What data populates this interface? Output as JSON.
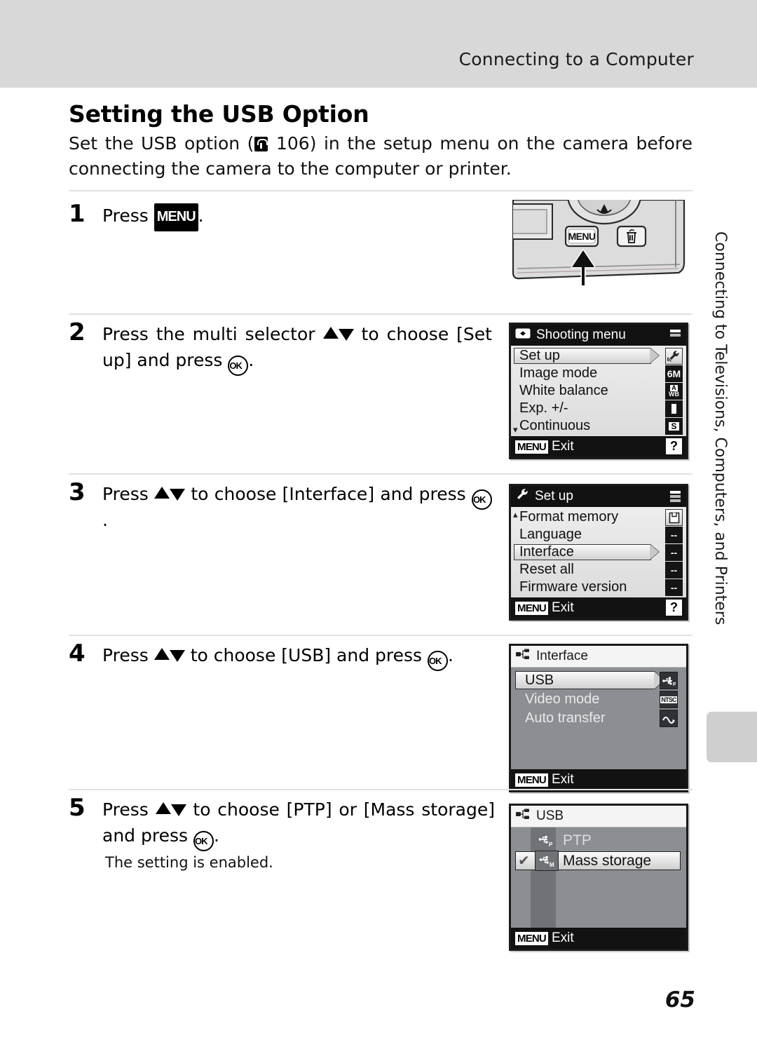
{
  "header": {
    "title": "Connecting to a Computer"
  },
  "heading": "Setting the USB Option",
  "intro": {
    "before": "Set the USB option (",
    "page_ref": "106",
    "after": ") in the setup menu on the camera before connecting the camera to the computer or printer."
  },
  "steps": [
    {
      "num": "1",
      "text_before": "Press ",
      "menu_label": "MENU",
      "text_after": "."
    },
    {
      "num": "2",
      "line1_a": "Press the multi selector ",
      "line1_b": " to choose [Set up] and press ",
      "ok_label": "OK",
      "line1_c": "."
    },
    {
      "num": "3",
      "line_a": "Press ",
      "line_b": " to choose [Interface] and press ",
      "ok_label": "OK",
      "line_c": "."
    },
    {
      "num": "4",
      "line_a": "Press ",
      "line_b": " to choose [USB] and press ",
      "ok_label": "OK",
      "line_c": "."
    },
    {
      "num": "5",
      "line_a": "Press ",
      "line_b": " to choose [PTP] or [Mass storage] and press ",
      "ok_label": "OK",
      "line_c": ".",
      "note": "The setting is enabled."
    }
  ],
  "camera": {
    "menu_button_label": "MENU",
    "delete_button_label": "trash-can"
  },
  "screens": {
    "shooting_menu": {
      "title": "Shooting menu",
      "title_icon": "camera-icon",
      "rows": [
        {
          "label": "Set up",
          "icon": "wrench-icon",
          "icon_text": "",
          "selected": true,
          "light_icon": true
        },
        {
          "label": "Image mode",
          "icon": "image-size-icon",
          "icon_text": "6M",
          "selected": false,
          "light_icon": false
        },
        {
          "label": "White balance",
          "icon": "white-balance-icon",
          "icon_text": "AWB",
          "selected": false,
          "light_icon": false
        },
        {
          "label": "Exp. +/-",
          "icon": "exposure-icon",
          "icon_text": "0",
          "selected": false,
          "light_icon": false
        },
        {
          "label": "Continuous",
          "icon": "continuous-icon",
          "icon_text": "S",
          "selected": false,
          "light_icon": false
        }
      ],
      "footer": {
        "menu": "MENU",
        "exit": "Exit",
        "help": "?"
      }
    },
    "setup_menu": {
      "title": "Set up",
      "title_icon": "wrench-icon",
      "rows": [
        {
          "label": "Format memory",
          "icon": "format-memory-icon",
          "icon_text": "",
          "selected": false,
          "light_icon": true
        },
        {
          "label": "Language",
          "icon": "dashes-icon",
          "icon_text": "--",
          "selected": false,
          "light_icon": false
        },
        {
          "label": "Interface",
          "icon": "dashes-icon",
          "icon_text": "--",
          "selected": true,
          "light_icon": false
        },
        {
          "label": "Reset all",
          "icon": "dashes-icon",
          "icon_text": "--",
          "selected": false,
          "light_icon": false
        },
        {
          "label": "Firmware version",
          "icon": "dashes-icon",
          "icon_text": "--",
          "selected": false,
          "light_icon": false
        }
      ],
      "footer": {
        "menu": "MENU",
        "exit": "Exit",
        "help": "?"
      }
    },
    "interface_menu": {
      "title": "Interface",
      "title_icon": "interface-icon",
      "rows": [
        {
          "label": "USB",
          "icon": "usb-ptp-icon",
          "icon_text": "",
          "selected": true
        },
        {
          "label": "Video mode",
          "icon": "video-ntsc-icon",
          "icon_text": "NTSC",
          "selected": false
        },
        {
          "label": "Auto transfer",
          "icon": "auto-transfer-icon",
          "icon_text": "",
          "selected": false
        }
      ],
      "footer": {
        "menu": "MENU",
        "exit": "Exit"
      }
    },
    "usb_menu": {
      "title": "USB",
      "title_icon": "interface-icon",
      "rows": [
        {
          "label": "PTP",
          "icon": "usb-ptp-icon",
          "icon_sub": "P",
          "selected": false,
          "checked": false
        },
        {
          "label": "Mass storage",
          "icon": "usb-mass-icon",
          "icon_sub": "M",
          "selected": true,
          "checked": true
        }
      ],
      "footer": {
        "menu": "MENU",
        "exit": "Exit"
      }
    }
  },
  "side_tab": "Connecting to Televisions, Computers, and Printers",
  "page_number": "65"
}
